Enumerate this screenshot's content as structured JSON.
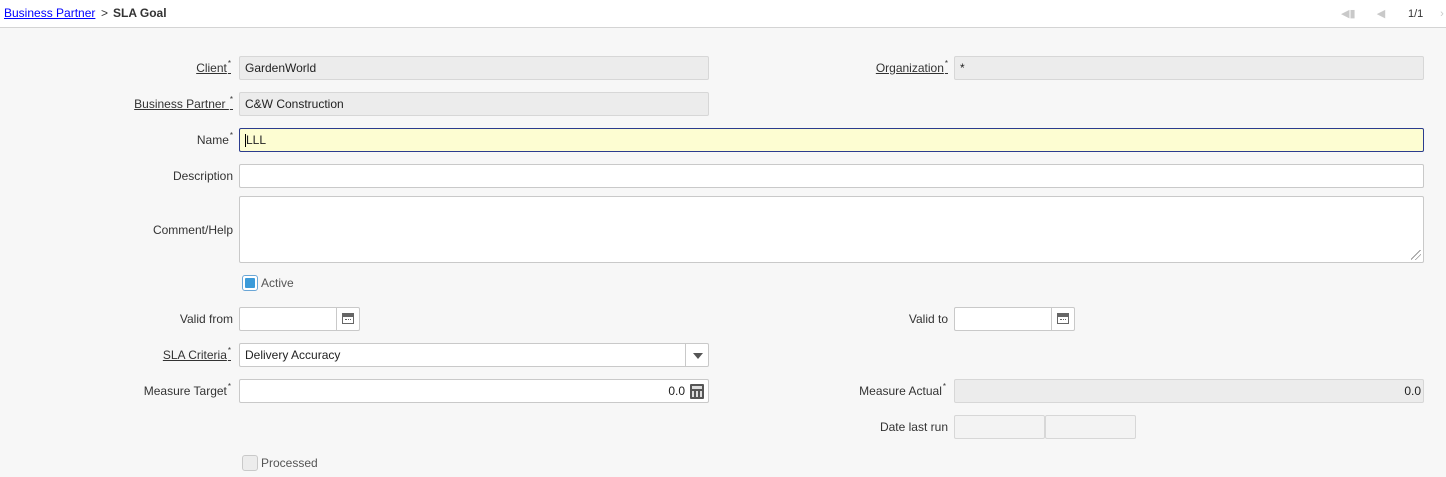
{
  "breadcrumb": {
    "parent": "Business Partner",
    "separator": ">",
    "current": "SLA Goal"
  },
  "navigation": {
    "record_count": "1/1",
    "icons": [
      "first-record-icon",
      "previous-record-icon",
      "next-record-icon"
    ]
  },
  "form": {
    "client": {
      "label": "Client",
      "required": "*",
      "value": "GardenWorld"
    },
    "organization": {
      "label": "Organization",
      "required": "*",
      "value": "*"
    },
    "business_partner": {
      "label": "Business Partner ",
      "required": "*",
      "value": "C&W Construction"
    },
    "name": {
      "label": "Name",
      "required": "*",
      "value": "LLL"
    },
    "description": {
      "label": "Description",
      "value": ""
    },
    "comment_help": {
      "label": "Comment/Help",
      "value": ""
    },
    "active": {
      "label": "Active",
      "checked": true
    },
    "valid_from": {
      "label": "Valid from",
      "value": ""
    },
    "valid_to": {
      "label": "Valid to",
      "value": ""
    },
    "sla_criteria": {
      "label": "SLA Criteria",
      "required": "*",
      "value": "Delivery Accuracy"
    },
    "measure_target": {
      "label": "Measure Target",
      "required": "*",
      "value": "0.0"
    },
    "measure_actual": {
      "label": "Measure Actual",
      "required": "*",
      "value": "0.0"
    },
    "date_last_run": {
      "label": "Date last run",
      "date": "",
      "time": ""
    },
    "processed": {
      "label": "Processed",
      "checked": false
    }
  },
  "colors": {
    "focus_bg": "#fdfdd2",
    "focus_border": "#2b3c8e",
    "readonly_bg": "#ececec",
    "link": "#0000ff",
    "checkbox_on": "#3a9ad9"
  }
}
